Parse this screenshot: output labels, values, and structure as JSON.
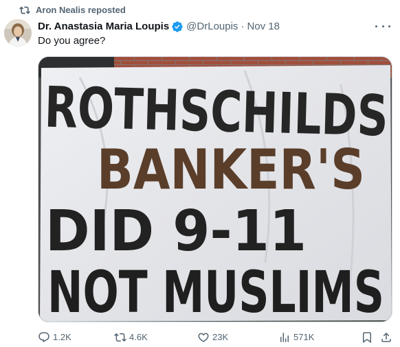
{
  "repost_banner": {
    "text": "Aron Nealis reposted"
  },
  "author": {
    "display_name": "Dr. Anastasia Maria Loupis",
    "verified": true,
    "handle": "@DrLoupis",
    "separator": "·",
    "date": "Nov 18"
  },
  "tweet": {
    "text": "Do you agree?"
  },
  "media": {
    "sign_lines": [
      "ROTHSCHILDS",
      "BANKER'S",
      "DID 9-11",
      "NOT MUSLIMS"
    ]
  },
  "actions": {
    "replies": "1.2K",
    "reposts": "4.6K",
    "likes": "23K",
    "views": "571K"
  },
  "colors": {
    "verified_badge": "#1d9bf0",
    "muted_text": "#536471",
    "primary_text": "#0f1419",
    "brick": "#9c4a3a",
    "banner_cloth": "#e8e9ec"
  },
  "icons": [
    "repost-icon",
    "verified-badge-icon",
    "more-icon",
    "reply-icon",
    "repost-icon",
    "like-icon",
    "views-icon",
    "bookmark-icon",
    "share-icon"
  ]
}
